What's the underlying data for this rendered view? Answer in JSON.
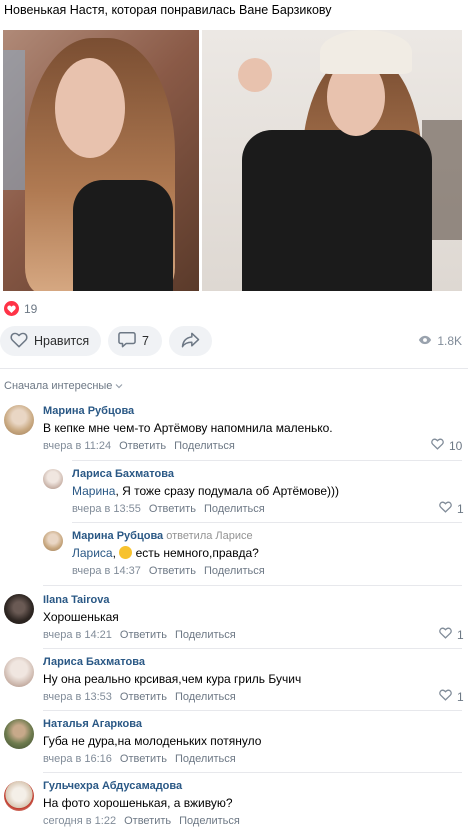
{
  "post": {
    "text": "Новенькая Настя, которая понравилась Ване Барзикову",
    "likes_count": "19",
    "actions": {
      "like_label": "Нравится",
      "comment_count": "7",
      "views": "1.8K"
    }
  },
  "sort_label": "Сначала интересные",
  "comments": [
    {
      "author": "Марина Рубцова",
      "text": "В кепке мне чем-то Артёмову напомнила маленько.",
      "time": "вчера в 11:24",
      "reply_label": "Ответить",
      "share_label": "Поделиться",
      "likes": "10"
    },
    {
      "author": "Лариса Бахматова",
      "mention": "Марина",
      "text": ", Я тоже сразу подумала об Артёмове)))",
      "time": "вчера в 13:55",
      "reply_label": "Ответить",
      "share_label": "Поделиться",
      "likes": "1"
    },
    {
      "author": "Марина Рубцова",
      "replied_to": "ответила Ларисе",
      "mention": "Лариса",
      "text": "есть немного,правда?",
      "time": "вчера в 14:37",
      "reply_label": "Ответить",
      "share_label": "Поделиться"
    },
    {
      "author": "Ilana Tairova",
      "text": "Хорошенькая",
      "time": "вчера в 14:21",
      "reply_label": "Ответить",
      "share_label": "Поделиться",
      "likes": "1"
    },
    {
      "author": "Лариса Бахматова",
      "text": "Ну она реально крсивая,чем кура гриль Бучич",
      "time": "вчера в 13:53",
      "reply_label": "Ответить",
      "share_label": "Поделиться",
      "likes": "1"
    },
    {
      "author": "Наталья Агаркова",
      "text": "Губа не дура,на молоденьких потянуло",
      "time": "вчера в 16:16",
      "reply_label": "Ответить",
      "share_label": "Поделиться"
    },
    {
      "author": "Гульчехра Абдусамадова",
      "text": "На фото хорошенькая, а вживую?",
      "time": "сегодня в 1:22",
      "reply_label": "Ответить",
      "share_label": "Поделиться"
    }
  ],
  "colors": {
    "link": "#2a5885",
    "heart": "#ff3347",
    "button_bg": "#f0f2f5",
    "muted": "#818c99"
  }
}
